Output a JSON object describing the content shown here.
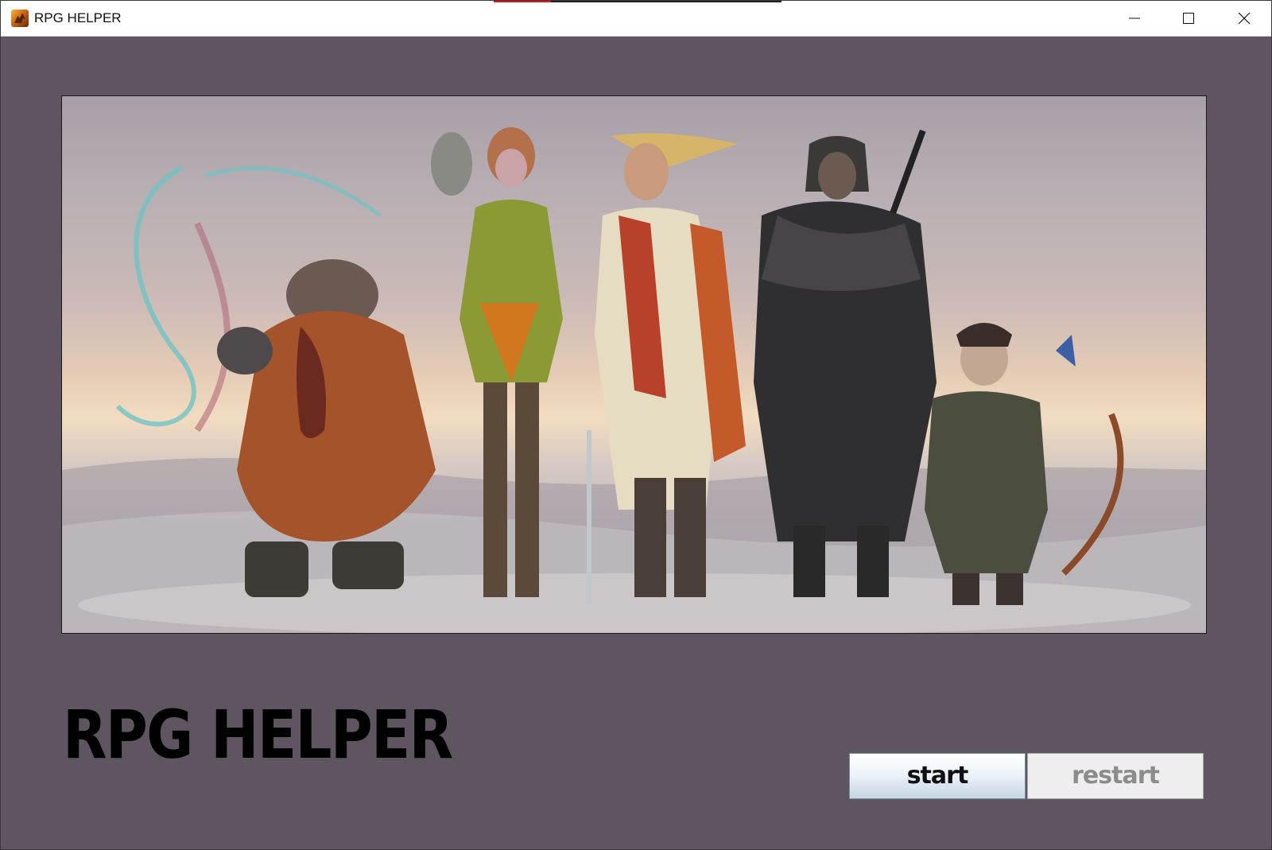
{
  "window": {
    "title": "RPG HELPER",
    "icon": "dragon-app-icon",
    "controls": {
      "minimize": "minimize-icon",
      "maximize": "maximize-icon",
      "close": "close-icon"
    }
  },
  "main": {
    "hero_image": "fantasy-adventurer-party-illustration",
    "app_title": "RPG HELPER",
    "buttons": {
      "start_label": "start",
      "restart_label": "restart",
      "restart_enabled": false
    }
  },
  "colors": {
    "background": "#5f5560",
    "title_text": "#000000",
    "disabled_text": "#8c8c8c"
  }
}
